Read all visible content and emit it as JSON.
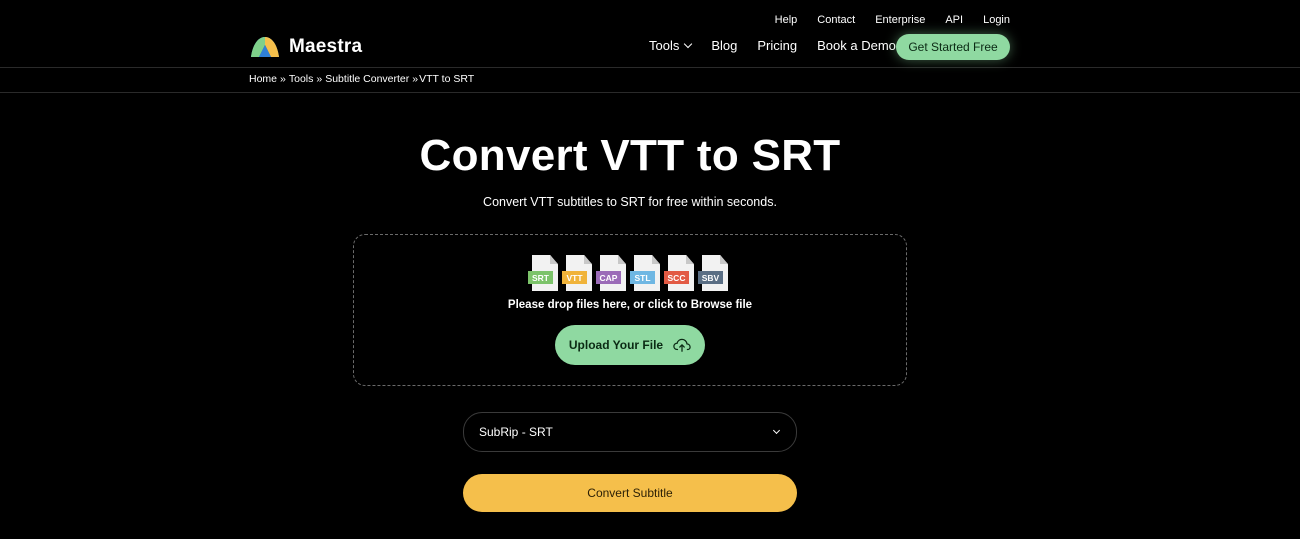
{
  "brand": {
    "name": "Maestra"
  },
  "util_nav": [
    "Help",
    "Contact",
    "Enterprise",
    "API",
    "Login"
  ],
  "main_nav": {
    "tools": "Tools",
    "blog": "Blog",
    "pricing": "Pricing",
    "demo": "Book a Demo"
  },
  "cta": "Get Started Free",
  "breadcrumb": {
    "home": "Home",
    "sep": "»",
    "tools": "Tools",
    "converter": "Subtitle Converter",
    "current": "VTT to SRT"
  },
  "hero": {
    "title": "Convert VTT to SRT",
    "subtitle": "Convert VTT subtitles to SRT for free within seconds."
  },
  "dropzone": {
    "formats": [
      {
        "label": "SRT",
        "color": "#7cc36a"
      },
      {
        "label": "VTT",
        "color": "#f0b33a"
      },
      {
        "label": "CAP",
        "color": "#9b6bb8"
      },
      {
        "label": "STL",
        "color": "#6fb7e3"
      },
      {
        "label": "SCC",
        "color": "#e25a44"
      },
      {
        "label": "SBV",
        "color": "#5a6e84"
      }
    ],
    "hint": "Please drop files here, or click to Browse file",
    "upload_label": "Upload Your File"
  },
  "format_select": {
    "value": "SubRip - SRT"
  },
  "convert_label": "Convert Subtitle",
  "colors": {
    "accent_green": "#8fd9a1",
    "accent_yellow": "#f5bf4b",
    "background": "#000000"
  }
}
